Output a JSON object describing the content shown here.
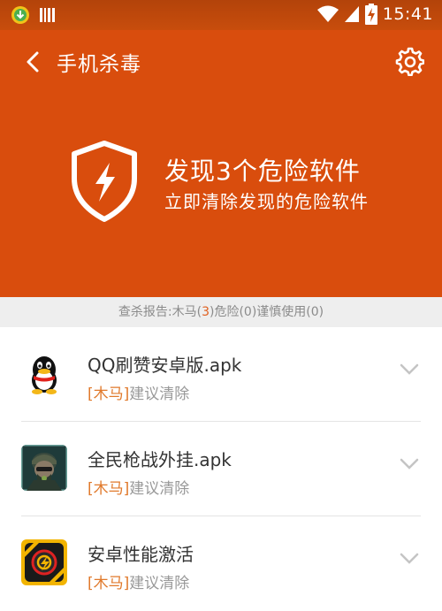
{
  "status_bar": {
    "time": "15:41"
  },
  "header": {
    "title": "手机杀毒"
  },
  "hero": {
    "title": "发现3个危险软件",
    "subtitle": "立即清除发现的危险软件"
  },
  "report": {
    "prefix": "查杀报告:木马(",
    "trojan_count": "3",
    "middle": ")危险(0)谨慎使用(0)"
  },
  "apps": [
    {
      "name": "QQ刷赞安卓版.apk",
      "tag": "[木马]",
      "action": "建议清除",
      "icon": "qq-penguin-icon"
    },
    {
      "name": "全民枪战外挂.apk",
      "tag": "[木马]",
      "action": "建议清除",
      "icon": "soldier-game-icon"
    },
    {
      "name": "安卓性能激活",
      "tag": "[木马]",
      "action": "建议清除",
      "icon": "performance-app-icon"
    }
  ],
  "colors": {
    "header_bg": "#d94d0d",
    "tag_orange": "#e0792b"
  }
}
